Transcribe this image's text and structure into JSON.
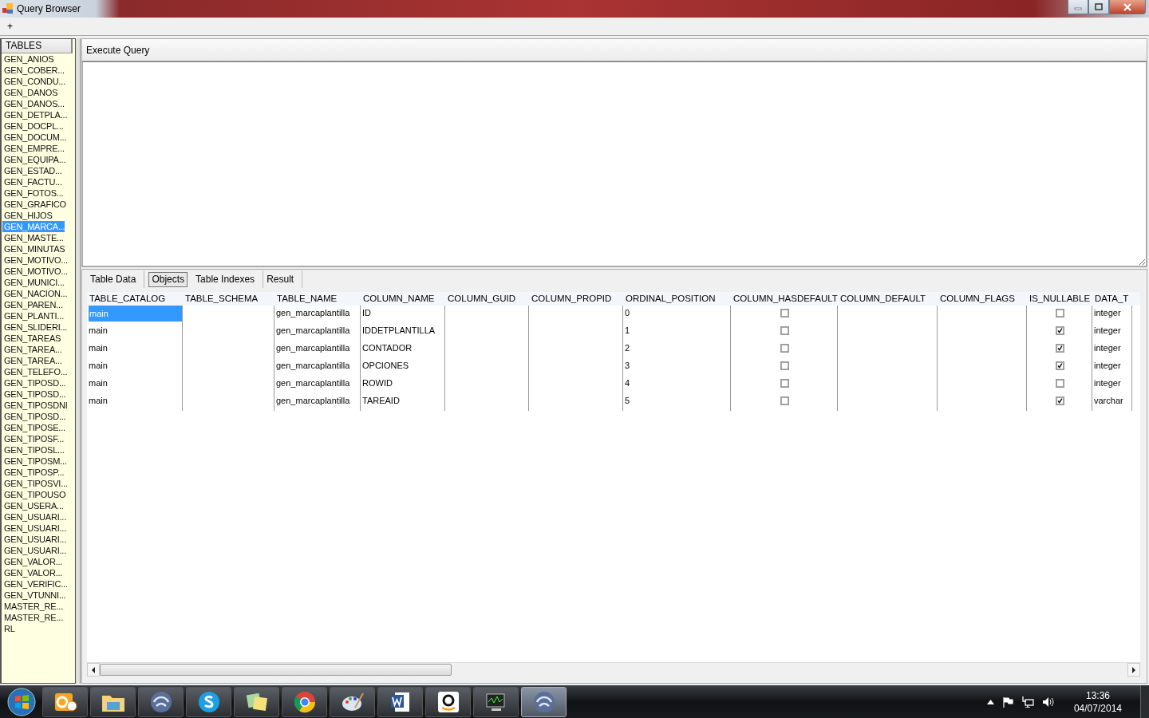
{
  "window": {
    "title": "Query Browser"
  },
  "menu": {
    "items": [
      "+"
    ]
  },
  "sidebar": {
    "header": "TABLES",
    "items": [
      {
        "label": "GEN_ANIOS",
        "selected": false
      },
      {
        "label": "GEN_COBER...",
        "selected": false
      },
      {
        "label": "GEN_CONDU...",
        "selected": false
      },
      {
        "label": "GEN_DANOS",
        "selected": false
      },
      {
        "label": "GEN_DANOS...",
        "selected": false
      },
      {
        "label": "GEN_DETPLA...",
        "selected": false
      },
      {
        "label": "GEN_DOCPL...",
        "selected": false
      },
      {
        "label": "GEN_DOCUM...",
        "selected": false
      },
      {
        "label": "GEN_EMPRE...",
        "selected": false
      },
      {
        "label": "GEN_EQUIPA...",
        "selected": false
      },
      {
        "label": "GEN_ESTAD...",
        "selected": false
      },
      {
        "label": "GEN_FACTU...",
        "selected": false
      },
      {
        "label": "GEN_FOTOS...",
        "selected": false
      },
      {
        "label": "GEN_GRAFICO",
        "selected": false
      },
      {
        "label": "GEN_HIJOS",
        "selected": false
      },
      {
        "label": "GEN_MARCA...",
        "selected": true
      },
      {
        "label": "GEN_MASTE...",
        "selected": false
      },
      {
        "label": "GEN_MINUTAS",
        "selected": false
      },
      {
        "label": "GEN_MOTIVO...",
        "selected": false
      },
      {
        "label": "GEN_MOTIVO...",
        "selected": false
      },
      {
        "label": "GEN_MUNICI...",
        "selected": false
      },
      {
        "label": "GEN_NACION...",
        "selected": false
      },
      {
        "label": "GEN_PAREN...",
        "selected": false
      },
      {
        "label": "GEN_PLANTI...",
        "selected": false
      },
      {
        "label": "GEN_SLIDERI...",
        "selected": false
      },
      {
        "label": "GEN_TAREAS",
        "selected": false
      },
      {
        "label": "GEN_TAREA...",
        "selected": false
      },
      {
        "label": "GEN_TAREA...",
        "selected": false
      },
      {
        "label": "GEN_TELEFO...",
        "selected": false
      },
      {
        "label": "GEN_TIPOSD...",
        "selected": false
      },
      {
        "label": "GEN_TIPOSD...",
        "selected": false
      },
      {
        "label": "GEN_TIPOSDNI",
        "selected": false
      },
      {
        "label": "GEN_TIPOSD...",
        "selected": false
      },
      {
        "label": "GEN_TIPOSE...",
        "selected": false
      },
      {
        "label": "GEN_TIPOSF...",
        "selected": false
      },
      {
        "label": "GEN_TIPOSL...",
        "selected": false
      },
      {
        "label": "GEN_TIPOSM...",
        "selected": false
      },
      {
        "label": "GEN_TIPOSP...",
        "selected": false
      },
      {
        "label": "GEN_TIPOSVI...",
        "selected": false
      },
      {
        "label": "GEN_TIPOUSO",
        "selected": false
      },
      {
        "label": "GEN_USERA...",
        "selected": false
      },
      {
        "label": "GEN_USUARI...",
        "selected": false
      },
      {
        "label": "GEN_USUARI...",
        "selected": false
      },
      {
        "label": "GEN_USUARI...",
        "selected": false
      },
      {
        "label": "GEN_USUARI...",
        "selected": false
      },
      {
        "label": "GEN_VALOR...",
        "selected": false
      },
      {
        "label": "GEN_VALOR...",
        "selected": false
      },
      {
        "label": "GEN_VERIFIC...",
        "selected": false
      },
      {
        "label": "GEN_VTUNNI...",
        "selected": false
      },
      {
        "label": "MASTER_RE...",
        "selected": false
      },
      {
        "label": "MASTER_RE...",
        "selected": false
      },
      {
        "label": "RL",
        "selected": false
      }
    ]
  },
  "query": {
    "button": "Execute Query"
  },
  "tabs": [
    {
      "label": "Table Data",
      "selected": false
    },
    {
      "label": "Objects",
      "selected": true
    },
    {
      "label": "Table Indexes",
      "selected": false
    },
    {
      "label": "Result",
      "selected": false
    }
  ],
  "table": {
    "columns": [
      {
        "label": "TABLE_CATALOG",
        "kind": "text"
      },
      {
        "label": "TABLE_SCHEMA",
        "kind": "text"
      },
      {
        "label": "TABLE_NAME",
        "kind": "text"
      },
      {
        "label": "COLUMN_NAME",
        "kind": "text"
      },
      {
        "label": "COLUMN_GUID",
        "kind": "text"
      },
      {
        "label": "COLUMN_PROPID",
        "kind": "text"
      },
      {
        "label": "ORDINAL_POSITION",
        "kind": "text"
      },
      {
        "label": "COLUMN_HASDEFAULT",
        "kind": "check"
      },
      {
        "label": "COLUMN_DEFAULT",
        "kind": "text"
      },
      {
        "label": "COLUMN_FLAGS",
        "kind": "text"
      },
      {
        "label": "IS_NULLABLE",
        "kind": "check"
      },
      {
        "label": "DATA_T",
        "kind": "text"
      }
    ],
    "rows": [
      {
        "selected": true,
        "cells": [
          {
            "text": "main"
          },
          {},
          {
            "text": "gen_marcaplantilla"
          },
          {
            "text": "ID"
          },
          {},
          {},
          {
            "text": "0"
          },
          {
            "checked": false
          },
          {},
          {},
          {
            "checked": false
          },
          {
            "text": "integer"
          }
        ]
      },
      {
        "selected": false,
        "cells": [
          {
            "text": "main"
          },
          {},
          {
            "text": "gen_marcaplantilla"
          },
          {
            "text": "IDDETPLANTILLA"
          },
          {},
          {},
          {
            "text": "1"
          },
          {
            "checked": false
          },
          {},
          {},
          {
            "checked": true
          },
          {
            "text": "integer"
          }
        ]
      },
      {
        "selected": false,
        "cells": [
          {
            "text": "main"
          },
          {},
          {
            "text": "gen_marcaplantilla"
          },
          {
            "text": "CONTADOR"
          },
          {},
          {},
          {
            "text": "2"
          },
          {
            "checked": false
          },
          {},
          {},
          {
            "checked": true
          },
          {
            "text": "integer"
          }
        ]
      },
      {
        "selected": false,
        "cells": [
          {
            "text": "main"
          },
          {},
          {
            "text": "gen_marcaplantilla"
          },
          {
            "text": "OPCIONES"
          },
          {},
          {},
          {
            "text": "3"
          },
          {
            "checked": false
          },
          {},
          {},
          {
            "checked": true
          },
          {
            "text": "integer"
          }
        ]
      },
      {
        "selected": false,
        "cells": [
          {
            "text": "main"
          },
          {},
          {
            "text": "gen_marcaplantilla"
          },
          {
            "text": "ROWID"
          },
          {},
          {},
          {
            "text": "4"
          },
          {
            "checked": false
          },
          {},
          {},
          {
            "checked": false
          },
          {
            "text": "integer"
          }
        ]
      },
      {
        "selected": false,
        "cells": [
          {
            "text": "main"
          },
          {},
          {
            "text": "gen_marcaplantilla"
          },
          {
            "text": "TAREAID"
          },
          {},
          {},
          {
            "text": "5"
          },
          {
            "checked": false
          },
          {},
          {},
          {
            "checked": true
          },
          {
            "text": "varchar"
          }
        ]
      }
    ]
  },
  "taskbar": {
    "apps": [
      {
        "kind": "mail",
        "selected": false
      },
      {
        "kind": "folder",
        "selected": false
      },
      {
        "kind": "swirl",
        "selected": false
      },
      {
        "kind": "phone",
        "selected": false
      },
      {
        "kind": "notes",
        "selected": false
      },
      {
        "kind": "browser",
        "selected": false
      },
      {
        "kind": "palette",
        "selected": false
      },
      {
        "kind": "document",
        "selected": false
      },
      {
        "kind": "cart",
        "selected": false
      },
      {
        "kind": "monitor",
        "selected": false
      },
      {
        "kind": "swirl",
        "selected": true
      }
    ],
    "time": "13:36",
    "date": "04/07/2014"
  }
}
